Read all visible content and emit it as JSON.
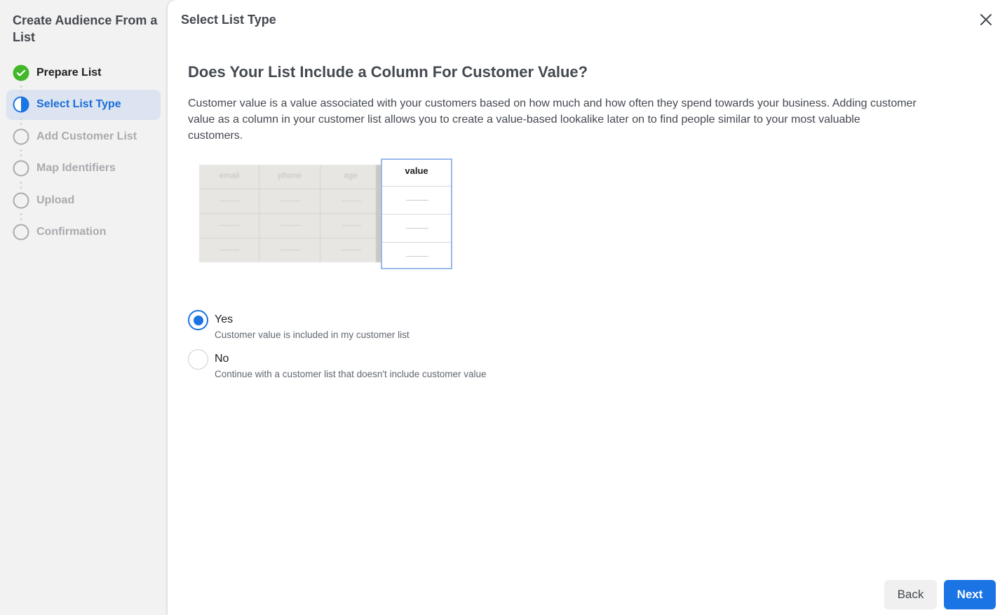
{
  "sidebar": {
    "title": "Create Audience From a List",
    "steps": [
      {
        "label": "Prepare List",
        "state": "done",
        "icon": "check-circle-icon"
      },
      {
        "label": "Select List Type",
        "state": "active",
        "icon": "half-circle-icon"
      },
      {
        "label": "Add Customer List",
        "state": "todo",
        "icon": "empty-circle-icon"
      },
      {
        "label": "Map Identifiers",
        "state": "todo",
        "icon": "empty-circle-icon"
      },
      {
        "label": "Upload",
        "state": "todo",
        "icon": "empty-circle-icon"
      },
      {
        "label": "Confirmation",
        "state": "todo",
        "icon": "empty-circle-icon"
      }
    ]
  },
  "header": {
    "title": "Select List Type",
    "close_icon": "close-icon"
  },
  "content": {
    "question": "Does Your List Include a Column For Customer Value?",
    "description": "Customer value is a value associated with your customers based on how much and how often they spend towards your business. Adding customer value as a column in your customer list allows you to create a value-based lookalike later on to find people similar to your most valuable customers.",
    "illustration": {
      "columns": [
        "email",
        "phone",
        "age"
      ],
      "highlight_column": "value"
    },
    "options": [
      {
        "label": "Yes",
        "sublabel": "Customer value is included in my customer list",
        "selected": true
      },
      {
        "label": "No",
        "sublabel": "Continue with a customer list that doesn't include customer value",
        "selected": false
      }
    ]
  },
  "footer": {
    "back_label": "Back",
    "next_label": "Next"
  },
  "colors": {
    "accent": "#1b74e4",
    "success": "#42b72a",
    "active_step_bg": "#dbe4f0",
    "sidebar_bg": "#f2f2f2"
  }
}
